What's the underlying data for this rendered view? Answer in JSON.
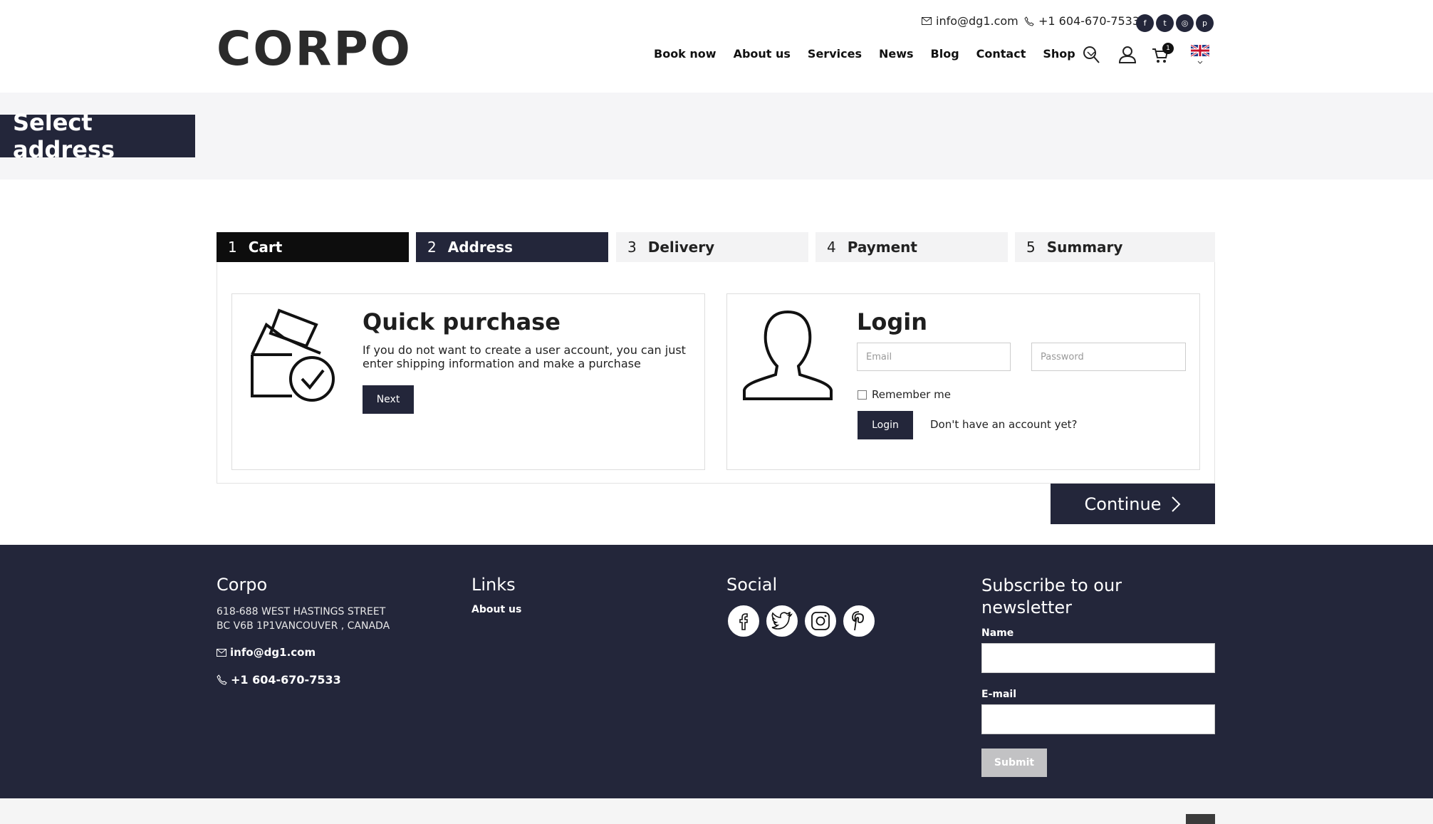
{
  "header": {
    "logo": "CORPO",
    "email": "info@dg1.com",
    "phone": "+1 604-670-7533",
    "nav": [
      "Book now",
      "About us",
      "Services",
      "News",
      "Blog",
      "Contact",
      "Shop"
    ],
    "cart_count": "1"
  },
  "page": {
    "title": "Select address"
  },
  "steps": [
    {
      "num": "1",
      "label": "Cart"
    },
    {
      "num": "2",
      "label": "Address"
    },
    {
      "num": "3",
      "label": "Delivery"
    },
    {
      "num": "4",
      "label": "Payment"
    },
    {
      "num": "5",
      "label": "Summary"
    }
  ],
  "quick": {
    "title": "Quick purchase",
    "desc_line1": "If you do not want to create a user account, you can just",
    "desc_line2": "enter shipping information and make a purchase",
    "next": "Next"
  },
  "login": {
    "title": "Login",
    "email_placeholder": "Email",
    "password_placeholder": "Password",
    "remember": "Remember me",
    "button": "Login",
    "no_account": "Don't have an account yet?"
  },
  "continue": "Continue",
  "footer": {
    "company": "Corpo",
    "address1": "618-688 WEST HASTINGS STREET",
    "address2": "BC V6B 1P1VANCOUVER , CANADA",
    "email": "info@dg1.com",
    "phone": "+1 604-670-7533",
    "links_title": "Links",
    "link1": "About us",
    "social_title": "Social",
    "newsletter_title_1": "Subscribe to our",
    "newsletter_title_2": "newsletter",
    "name_label": "Name",
    "email_label": "E-mail",
    "submit": "Submit"
  },
  "colors": {
    "navy": "#23263a",
    "black": "#0d0d0d",
    "band": "#f5f5f7"
  }
}
